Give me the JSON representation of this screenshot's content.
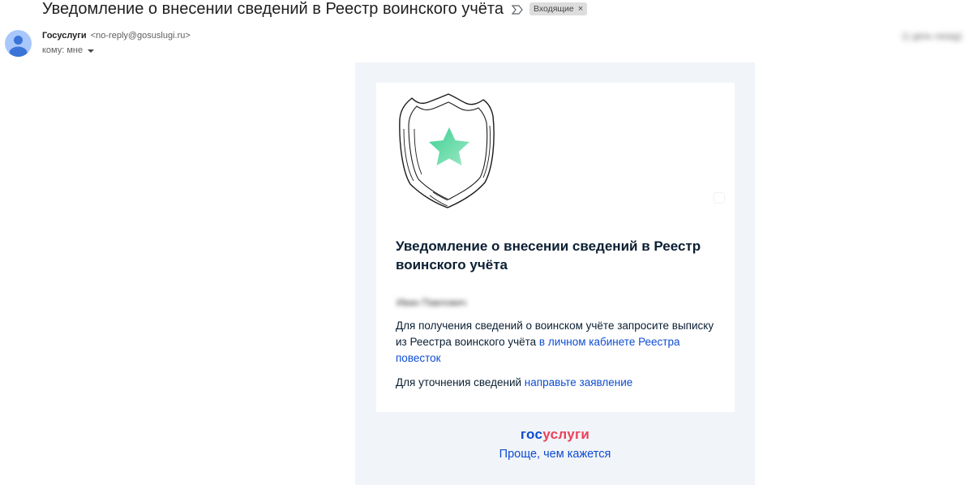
{
  "email": {
    "subject": "Уведомление о внесении сведений в Реестр воинского учёта",
    "label": "Входящие",
    "label_close": "×",
    "sender_name": "Госуслуги",
    "sender_email": "<no-reply@gosuslugi.ru>",
    "recipient": "кому: мне",
    "date": "(1 день назад)"
  },
  "body": {
    "title": "Уведомление о внесении сведений в Реестр воинского учёта",
    "greeting": "Иван Павлович",
    "paragraph1_text": "Для получения сведений о воинском учёте запросите выписку из Реестра воинского учёта ",
    "paragraph1_link": "в личном кабинете Реестра повесток",
    "paragraph2_text": "Для уточнения сведений ",
    "paragraph2_link": "направьте заявление"
  },
  "footer": {
    "logo_part1": "гос",
    "logo_part2": "услуги",
    "slogan": "Проще, чем кажется"
  },
  "colors": {
    "brand_blue": "#0d4cd3",
    "brand_red": "#ee3f58",
    "star_green": "#34c38f",
    "outer_bg": "#f1f4f8"
  }
}
